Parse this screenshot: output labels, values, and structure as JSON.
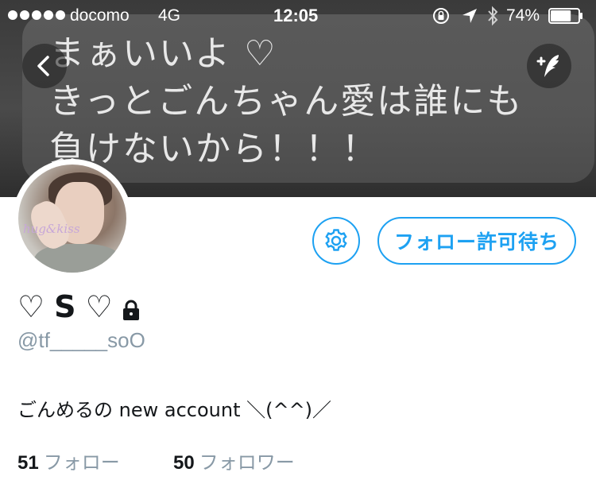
{
  "status_bar": {
    "carrier": "docomo",
    "network": "4G",
    "time": "12:05",
    "battery_percent": "74%",
    "battery_level": 0.74,
    "signal_dots": 5
  },
  "banner": {
    "lines": [
      "まぁいいよ ♡",
      "きっとごんちゃん愛は誰にも",
      "負けないから！！！"
    ]
  },
  "avatar": {
    "overlay_text": "hug&kiss"
  },
  "actions": {
    "follow_pending_label": "フォロー許可待ち"
  },
  "profile": {
    "display_name_left": "♡",
    "display_name_mid": "S",
    "display_name_right": "♡",
    "handle": "@tf_____soO",
    "bio": "ごんめるの new account ＼(^^)／"
  },
  "stats": {
    "following_count": "51",
    "following_label": "フォロー",
    "followers_count": "50",
    "followers_label": "フォロワー"
  },
  "icons": {
    "back": "chevron-left-icon",
    "compose": "compose-tweet-icon",
    "settings": "gear-icon",
    "protected": "lock-icon"
  },
  "colors": {
    "accent": "#1da1f2",
    "secondary_text": "#8899a6",
    "primary_text": "#14171a"
  }
}
